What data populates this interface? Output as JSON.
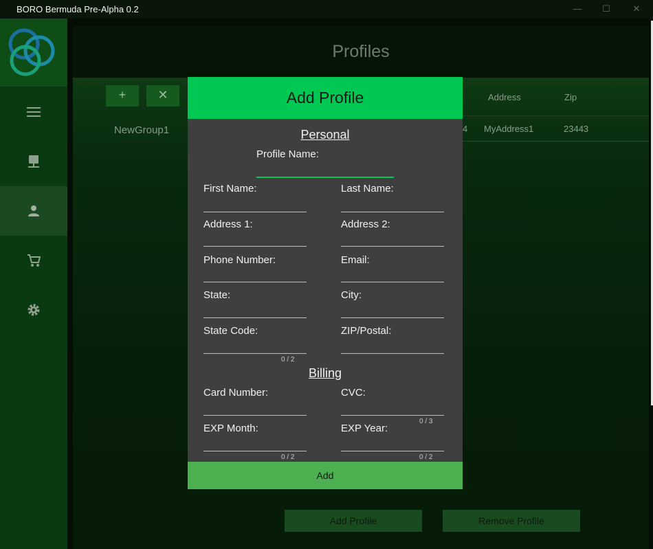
{
  "window": {
    "title": "BORO Bermuda Pre-Alpha 0.2",
    "min": "—",
    "max": "☐",
    "close": "✕"
  },
  "sidebar": {
    "items": [
      "menu-icon",
      "server-icon",
      "person-icon",
      "cart-icon",
      "gear-icon"
    ]
  },
  "page": {
    "title": "Profiles"
  },
  "toolbar": {
    "add": "+",
    "remove": "✕"
  },
  "groups": [
    "NewGroup1"
  ],
  "table": {
    "headers": {
      "address": "Address",
      "zip": "Zip"
    },
    "row": {
      "partial": "4",
      "address": "MyAddress1",
      "zip": "23443"
    }
  },
  "footer": {
    "add_profile": "Add Profile",
    "remove_profile": "Remove Profile"
  },
  "dialog": {
    "title": "Add Profile",
    "personal_title": "Personal",
    "billing_title": "Billing",
    "profile_name": "Profile Name:",
    "first_name": "First Name:",
    "last_name": "Last Name:",
    "address1": "Address 1:",
    "address2": "Address 2:",
    "phone": "Phone Number:",
    "email": "Email:",
    "state": "State:",
    "city": "City:",
    "state_code": "State Code:",
    "state_code_counter": "0 / 2",
    "zip": "ZIP/Postal:",
    "card_number": "Card Number:",
    "cvc": "CVC:",
    "cvc_counter": "0 / 3",
    "exp_month": "EXP Month:",
    "exp_month_counter": "0 / 2",
    "exp_year": "EXP Year:",
    "exp_year_counter": "0 / 2",
    "submit": "Add"
  },
  "colors": {
    "accent": "#00c853",
    "add_button": "#4caf50",
    "sidebar": "#0a3a12",
    "dialog_bg": "#3f3f3f"
  }
}
